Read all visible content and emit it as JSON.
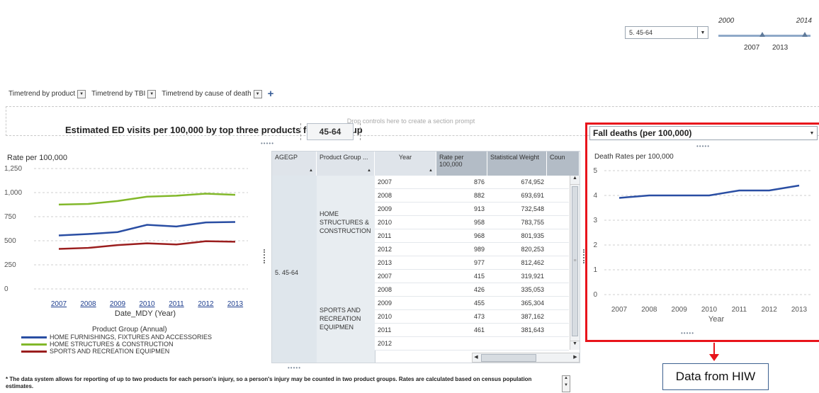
{
  "age_filter": {
    "value": "5. 45-64"
  },
  "slider": {
    "min": "2000",
    "max": "2014",
    "low": "2007",
    "high": "2013"
  },
  "tabs": [
    {
      "label": "Timetrend by product"
    },
    {
      "label": "Timetrend by TBI"
    },
    {
      "label": "Timetrend by cause of death"
    }
  ],
  "add_tab_label": "+",
  "drop_zone_text": "Drop controls here to create a section prompt",
  "left_panel": {
    "title": "Estimated ED visits per 100,000 by top three products for age group",
    "age_value": "45-64",
    "chart_ylabel": "Rate per 100,000",
    "chart_xlabel": "Date_MDY (Year)",
    "legend_title": "Product Group (Annual)"
  },
  "chart_data": [
    {
      "type": "line",
      "ylabel": "Rate per 100,000",
      "xlabel": "Date_MDY (Year)",
      "ylim": [
        0,
        1250
      ],
      "yticks": [
        "0",
        "250",
        "500",
        "750",
        "1,000",
        "1,250"
      ],
      "x": [
        "2007",
        "2008",
        "2009",
        "2010",
        "2011",
        "2012",
        "2013"
      ],
      "grid": true,
      "legend_title": "Product Group (Annual)",
      "legend_position": "bottom-left",
      "series": [
        {
          "name": "HOME FURNISHINGS, FIXTURES AND ACCESSORIES",
          "color": "#2a4ea3",
          "values": [
            555,
            570,
            590,
            665,
            648,
            690,
            695
          ]
        },
        {
          "name": "HOME STRUCTURES & CONSTRUCTION",
          "color": "#82b82a",
          "values": [
            876,
            882,
            913,
            958,
            968,
            989,
            977
          ]
        },
        {
          "name": "SPORTS AND RECREATION EQUIPMEN",
          "color": "#9b1e1e",
          "values": [
            415,
            426,
            455,
            473,
            461,
            495,
            490
          ]
        }
      ]
    },
    {
      "type": "line",
      "title": "Fall deaths (per 100,000)",
      "ylabel": "Death Rates per 100,000",
      "xlabel": "Year",
      "ylim": [
        0,
        5
      ],
      "yticks": [
        "0",
        "1",
        "2",
        "3",
        "4",
        "5"
      ],
      "x": [
        "2007",
        "2008",
        "2009",
        "2010",
        "2011",
        "2012",
        "2013"
      ],
      "grid": true,
      "series": [
        {
          "color": "#2a4ea3",
          "values": [
            3.9,
            4.0,
            4.0,
            4.0,
            4.2,
            4.2,
            4.4
          ]
        }
      ]
    }
  ],
  "table": {
    "headers": [
      "AGEGP",
      "Product Group ...",
      "Year",
      "Rate per 100,000",
      "Statistical Weight",
      "Coun"
    ],
    "agegp_value": "5. 45-64",
    "groups": [
      {
        "name": "HOME STRUCTURES & CONSTRUCTION",
        "rows": [
          {
            "year": "2007",
            "rate": "876",
            "weight": "674,952"
          },
          {
            "year": "2008",
            "rate": "882",
            "weight": "693,691"
          },
          {
            "year": "2009",
            "rate": "913",
            "weight": "732,548"
          },
          {
            "year": "2010",
            "rate": "958",
            "weight": "783,755"
          },
          {
            "year": "2011",
            "rate": "968",
            "weight": "801,935"
          },
          {
            "year": "2012",
            "rate": "989",
            "weight": "820,253"
          },
          {
            "year": "2013",
            "rate": "977",
            "weight": "812,462"
          }
        ]
      },
      {
        "name": "SPORTS AND RECREATION EQUIPMEN",
        "rows": [
          {
            "year": "2007",
            "rate": "415",
            "weight": "319,921"
          },
          {
            "year": "2008",
            "rate": "426",
            "weight": "335,053"
          },
          {
            "year": "2009",
            "rate": "455",
            "weight": "365,304"
          },
          {
            "year": "2010",
            "rate": "473",
            "weight": "387,162"
          },
          {
            "year": "2011",
            "rate": "461",
            "weight": "381,643"
          },
          {
            "year": "2012",
            "rate": "",
            "weight": ""
          }
        ]
      }
    ]
  },
  "right_panel": {
    "dropdown_value": "Fall deaths (per 100,000)",
    "chart_ylabel": "Death Rates per 100,000",
    "chart_xlabel": "Year"
  },
  "footnote": "* The data system allows for reporting of up to two products for each person's injury, so a person's injury may be counted in two product groups. Rates are calculated based on census population estimates.",
  "callout": {
    "text": "Data from HIW",
    "highlight_color": "#e8141b"
  }
}
